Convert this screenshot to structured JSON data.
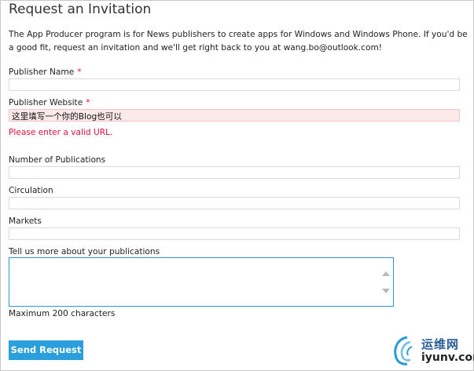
{
  "page": {
    "title": "Request an Invitation",
    "intro": "The App Producer program is for News publishers to create apps for Windows and Windows Phone. If you'd be a good fit, request an invitation and we'll get right back to you at wang.bo@outlook.com!"
  },
  "form": {
    "publisher_name": {
      "label": "Publisher Name",
      "required_mark": "*",
      "value": ""
    },
    "publisher_website": {
      "label": "Publisher Website",
      "required_mark": "*",
      "value": "这里填写一个你的Blog也可以",
      "error": "Please enter a valid URL."
    },
    "number_of_publications": {
      "label": "Number of Publications",
      "value": ""
    },
    "circulation": {
      "label": "Circulation",
      "value": ""
    },
    "markets": {
      "label": "Markets",
      "value": ""
    },
    "publications_detail": {
      "label": "Tell us more about your publications",
      "value": "",
      "note": "Maximum 200 characters"
    },
    "submit_label": "Send Request"
  },
  "watermark": {
    "cn": "运维网",
    "en": "iyunv.com"
  },
  "colors": {
    "accent": "#2b9fdb",
    "error": "#e0103a",
    "invalid_bg": "#fde9ea"
  }
}
